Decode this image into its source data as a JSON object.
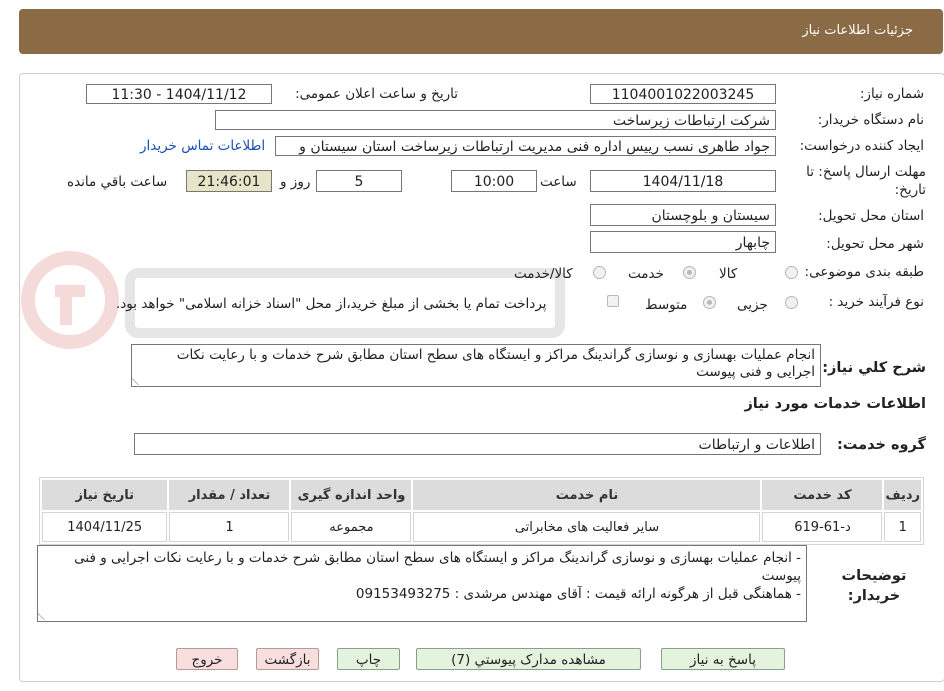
{
  "header": {
    "title": "جزئیات اطلاعات نیاز"
  },
  "fields": {
    "need_number_label": "شماره نیاز:",
    "need_number": "1104001022003245",
    "announce_label": "تاریخ و ساعت اعلان عمومی:",
    "announce_value": "1404/11/12 - 11:30",
    "buyer_org_label": "نام دستگاه خریدار:",
    "buyer_org": "شرکت ارتباطات زیرساخت",
    "requester_label": "ایجاد کننده درخواست:",
    "requester": "جواد طاهری نسب رییس اداره فنی مدیریت ارتباطات زیرساخت استان سیستان و",
    "contact_link": "اطلاعات تماس خریدار",
    "deadline_label": "مهلت ارسال پاسخ: تا تاریخ:",
    "deadline_date": "1404/11/18",
    "time_label": "ساعت",
    "deadline_time": "10:00",
    "days_value": "5",
    "days_label": "روز و",
    "remaining_time": "21:46:01",
    "remaining_label": "ساعت باقي مانده",
    "province_label": "استان محل تحویل:",
    "province": "سیستان و بلوچستان",
    "city_label": "شهر محل تحویل:",
    "city": "چابهار",
    "category_label": "طبقه بندی موضوعی:",
    "category_options": [
      "کالا",
      "خدمت",
      "کالا/خدمت"
    ],
    "process_label": "نوع فرآیند خرید :",
    "process_options": [
      "جزیی",
      "متوسط"
    ],
    "payment_note": "پرداخت تمام یا بخشی از مبلغ خرید،از محل \"اسناد خزانه اسلامی\" خواهد بود.",
    "summary_label": "شرح کلي نياز:",
    "summary": "انجام عملیات بهسازی و نوسازی گراندینگ مراکز و ایستگاه های سطح استان مطابق شرح خدمات و با رعایت نکات اجرایی و فنی پیوست"
  },
  "services": {
    "section_title": "اطلاعات خدمات مورد نیاز",
    "group_label": "گروه خدمت:",
    "group_value": "اطلاعات و ارتباطات",
    "columns": [
      "ردیف",
      "کد خدمت",
      "نام خدمت",
      "واحد اندازه گیری",
      "تعداد / مقدار",
      "تاریخ نیاز"
    ],
    "rows": [
      [
        "1",
        "د-61-619",
        "سایر فعالیت های مخابراتی",
        "مجموعه",
        "1",
        "1404/11/25"
      ]
    ]
  },
  "buyer_notes": {
    "label": "توضیحات خریدار:",
    "line1": "-  انجام عملیات بهسازی و نوسازی گراندینگ مراکز و ایستگاه های سطح استان مطابق شرح خدمات و با رعایت نکات اجرایی و فنی پیوست",
    "line2": "- هماهنگی قبل از هرگونه ارائه قیمت : آقای مهندس مرشدی : 09153493275"
  },
  "buttons": {
    "respond": "پاسخ به نیاز",
    "view_docs": "مشاهده مدارک پیوستي (7)",
    "print": "چاپ",
    "back": "بازگشت",
    "exit": "خروج"
  },
  "colors": {
    "header_bg": "#8a6b45",
    "button_green": "#e3f3dd",
    "button_pink": "#f9dede",
    "link": "#1a4fb4"
  }
}
